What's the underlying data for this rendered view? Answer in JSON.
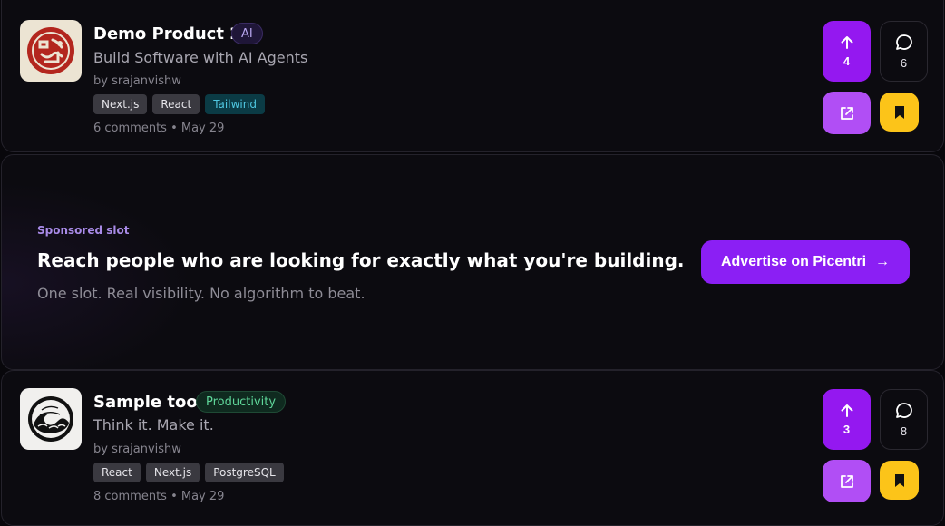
{
  "products": [
    {
      "title": "Demo Product 2",
      "category": "AI",
      "tagline": "Build Software with AI Agents",
      "byline": "by srajanvishw",
      "tags": [
        "Next.js",
        "React",
        "Tailwind"
      ],
      "meta": "6 comments • May 29",
      "upvotes": "4",
      "comments": "6",
      "logo_icon": "red-seal-icon"
    },
    {
      "title": "Sample tool",
      "category": "Productivity",
      "tagline": "Think it. Make it.",
      "byline": "by srajanvishw",
      "tags": [
        "React",
        "Next.js",
        "PostgreSQL"
      ],
      "meta": "8 comments • May 29",
      "upvotes": "3",
      "comments": "8",
      "logo_icon": "wave-icon"
    }
  ],
  "sponsored": {
    "label": "Sponsored slot",
    "headline": "Reach people who are looking for exactly what you're building.",
    "subtext": "One slot. Real visibility. No algorithm to beat.",
    "button_label": "Advertise on Picentri",
    "button_arrow": "→"
  },
  "colors": {
    "vote": "#9418f0",
    "external": "#b14ef5",
    "bookmark": "#fcc419",
    "accent": "#8b1ff4"
  }
}
